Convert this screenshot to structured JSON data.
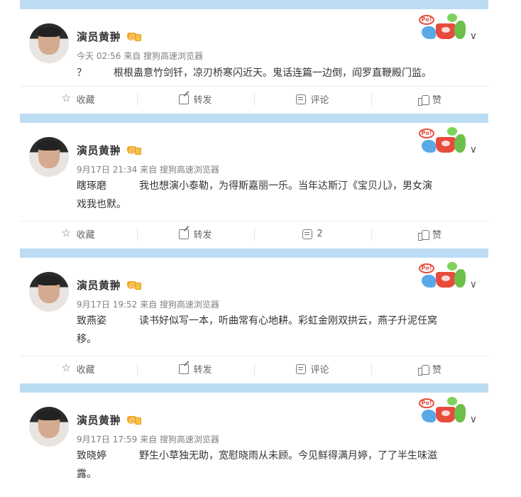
{
  "author": "演员黄翀",
  "actions": {
    "favorite": "收藏",
    "repost": "转发",
    "comment": "评论",
    "like": "赞"
  },
  "posts": [
    {
      "meta": "今天 02:56 来自 搜狗高速浏览器",
      "prefix": "？",
      "text": "根根蛊意竹剑钎，凉刃桥寒闪近天。鬼话连篇一边倒，阎罗直鞭殿门监。",
      "comment_label": "评论"
    },
    {
      "meta": "9月17日 21:34 来自 搜狗高速浏览器",
      "prefix": "瞎琢磨",
      "text": "我也想演小泰勒，为得斯嘉丽一乐。当年达斯汀《宝贝儿》，男女演",
      "text2": "戏我也默。",
      "comment_label": "2"
    },
    {
      "meta": "9月17日 19:52 来自 搜狗高速浏览器",
      "prefix": "致燕姿",
      "text": "读书好似写一本，听曲常有心地耕。彩虹金刚双拱云，燕子升泥任窝",
      "text2": "移。",
      "comment_label": "评论"
    },
    {
      "meta": "9月17日 17:59 来自 搜狗高速浏览器",
      "prefix": "致晓婷",
      "text": "野生小草独无助，宽慰晓雨从未顾。今见鲜得满月婷，了了半生味滋",
      "text2": "露。"
    }
  ],
  "icons": {
    "favorite": "star-icon",
    "repost": "share-icon",
    "comment": "comment-icon",
    "like": "thumbs-up-icon",
    "vip": "vip-badge-icon",
    "menu": "chevron-down-icon",
    "decoration": "card-decoration-icon"
  },
  "colors": {
    "separator": "#bcdcf4",
    "text": "#333333",
    "meta": "#808080",
    "vip": "#f5a623"
  }
}
